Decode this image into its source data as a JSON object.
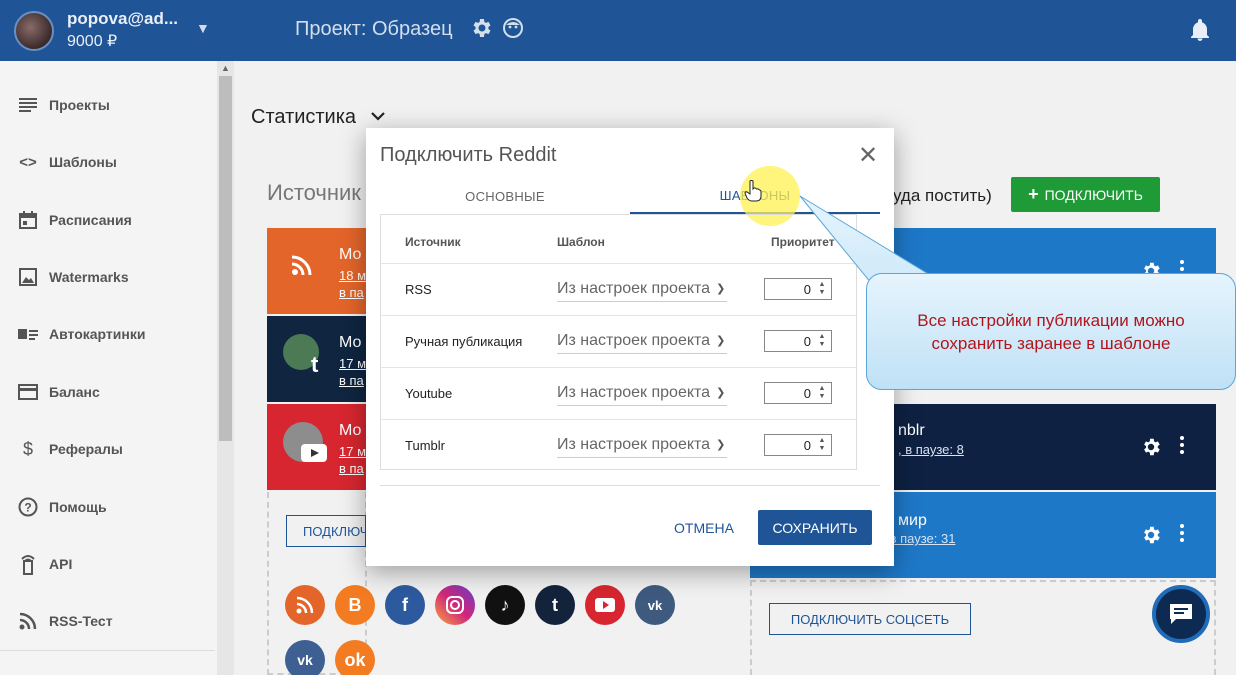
{
  "header": {
    "user_email": "popova@ad...",
    "balance": "9000 ₽",
    "project_title": "Проект: Образец"
  },
  "sidebar": {
    "items": [
      {
        "label": "Проекты",
        "icon": "list-icon"
      },
      {
        "label": "Шаблоны",
        "icon": "code-icon"
      },
      {
        "label": "Расписания",
        "icon": "calendar-icon"
      },
      {
        "label": "Watermarks",
        "icon": "image-icon"
      },
      {
        "label": "Автокартинки",
        "icon": "autopicture-icon"
      },
      {
        "label": "Баланс",
        "icon": "card-icon"
      },
      {
        "label": "Рефералы",
        "icon": "dollar-icon"
      },
      {
        "label": "Помощь",
        "icon": "help-icon"
      },
      {
        "label": "API",
        "icon": "api-icon"
      },
      {
        "label": "RSS-Тест",
        "icon": "rss-icon"
      }
    ]
  },
  "main": {
    "stats_title": "Статистика",
    "sources_title": "Источник",
    "where_text": "уда постить)",
    "connect_button": "ПОДКЛЮЧИТЬ",
    "connect_outline_left": "ПОДКЛЮЧ",
    "connect_social": "ПОДКЛЮЧИТЬ СОЦСЕТЬ",
    "left_cards": [
      {
        "title": "Мо",
        "line1": "18 м",
        "line2": "в па"
      },
      {
        "title": "Мо",
        "line1": "17 м",
        "line2": "в па"
      },
      {
        "title": "Мо",
        "line1": "17 м",
        "line2": "в па"
      }
    ],
    "right_cards": [
      {
        "title": "nblr",
        "sub": ", в паузе: 8"
      },
      {
        "title": "мир",
        "sub": "вд, в паузе: 31"
      }
    ]
  },
  "dialog": {
    "title": "Подключить Reddit",
    "tabs": [
      "ОСНОВНЫЕ",
      "ШАБЛОНЫ"
    ],
    "columns": [
      "Источник",
      "Шаблон",
      "Приоритет"
    ],
    "rows": [
      {
        "source": "RSS",
        "template": "Из настроек проекта",
        "priority": "0"
      },
      {
        "source": "Ручная публикация",
        "template": "Из настроек проекта",
        "priority": "0"
      },
      {
        "source": "Youtube",
        "template": "Из настроек проекта",
        "priority": "0"
      },
      {
        "source": "Tumblr",
        "template": "Из настроек проекта",
        "priority": "0"
      }
    ],
    "cancel": "ОТМЕНА",
    "save": "СОХРАНИТЬ"
  },
  "callout": {
    "line1": "Все настройки публикации можно",
    "line2": "сохранить заранее в шаблоне"
  },
  "colors": {
    "header": "#1f5597",
    "accent_green": "#1e9a36",
    "callout_text": "#b3141b"
  }
}
